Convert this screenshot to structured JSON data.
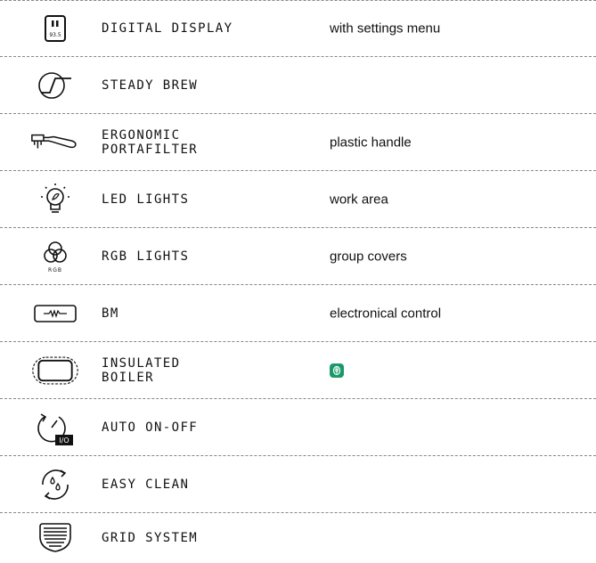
{
  "features": [
    {
      "icon": "digital-display-icon",
      "icon_text": "93.5",
      "label": "DIGITAL DISPLAY",
      "description": "with settings menu"
    },
    {
      "icon": "steady-brew-icon",
      "label": "STEADY BREW",
      "description": ""
    },
    {
      "icon": "portafilter-icon",
      "label": "ERGONOMIC\nPORTAFILTER",
      "description": "plastic handle"
    },
    {
      "icon": "led-bulb-icon",
      "label": "LED LIGHTS",
      "description": "work area"
    },
    {
      "icon": "rgb-circles-icon",
      "icon_text": "RGB",
      "label": "RGB LIGHTS",
      "description": "group covers"
    },
    {
      "icon": "bm-control-icon",
      "label": "BM",
      "description": "electronical control"
    },
    {
      "icon": "insulated-boiler-icon",
      "label": "INSULATED\nBOILER",
      "description": "",
      "badge_icon": "leaf-icon",
      "badge_color": "#1a9a6a"
    },
    {
      "icon": "auto-on-off-icon",
      "icon_text": "I/O",
      "label": "AUTO ON-OFF",
      "description": ""
    },
    {
      "icon": "easy-clean-icon",
      "label": "EASY CLEAN",
      "description": ""
    },
    {
      "icon": "grid-system-icon",
      "label": "GRID SYSTEM",
      "description": ""
    }
  ]
}
